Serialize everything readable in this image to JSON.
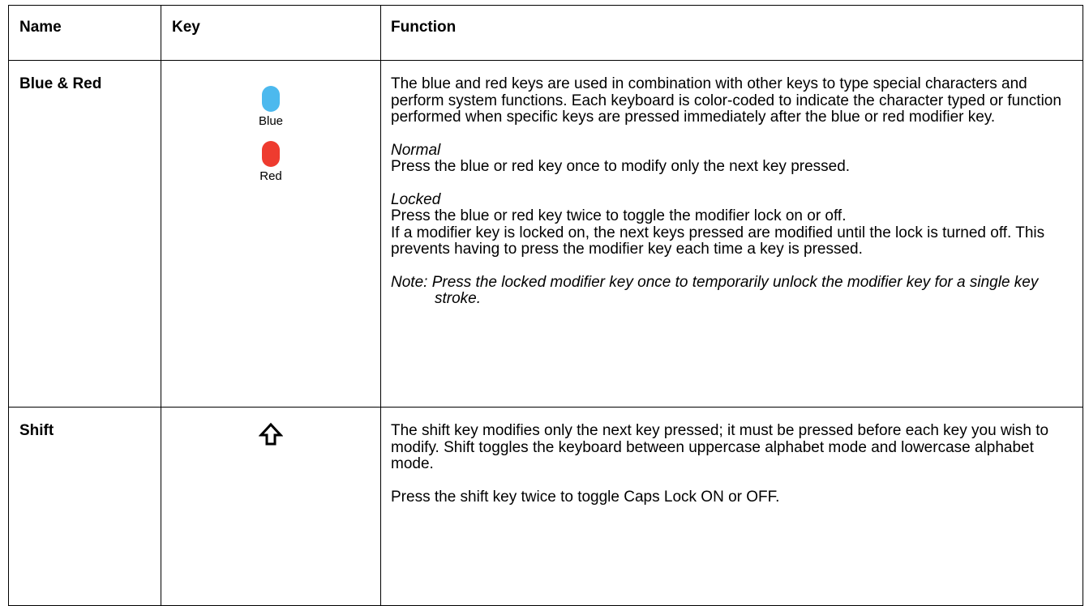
{
  "table": {
    "headers": {
      "name": "Name",
      "key": "Key",
      "function": "Function"
    },
    "rows": [
      {
        "name": "Blue & Red",
        "keys": [
          {
            "label": "Blue",
            "color": "#4cb9ee",
            "icon": "blue-modifier-key-icon"
          },
          {
            "label": "Red",
            "color": "#ee3b2f",
            "icon": "red-modifier-key-icon"
          }
        ],
        "function": {
          "intro": "The blue and red keys are used in combination with other keys to type special characters and perform system functions. Each keyboard is color-coded to indicate the character typed or function performed when specific keys are pressed immediately after the blue or red modifier key.",
          "normal_heading": "Normal",
          "normal_text": "Press the blue or red key once to modify only the next key pressed.",
          "locked_heading": "Locked",
          "locked_text_1": "Press the blue or red key twice to toggle the modifier lock on or off.",
          "locked_text_2": "If a modifier key is locked on, the next keys pressed are modified until the lock is turned off. This prevents having to press the modifier key each time a key is pressed.",
          "note": "Note: Press the locked modifier key once to temporarily unlock the modifier key for a single key stroke."
        }
      },
      {
        "name": "Shift",
        "keys": [
          {
            "icon": "shift-arrow-icon"
          }
        ],
        "function": {
          "text_1": "The shift key modifies only the next key pressed; it must be pressed before each key you wish to modify. Shift toggles the keyboard between uppercase alphabet mode and lowercase alphabet mode.",
          "text_2": "Press the shift key twice to toggle Caps Lock ON or OFF."
        }
      }
    ]
  }
}
